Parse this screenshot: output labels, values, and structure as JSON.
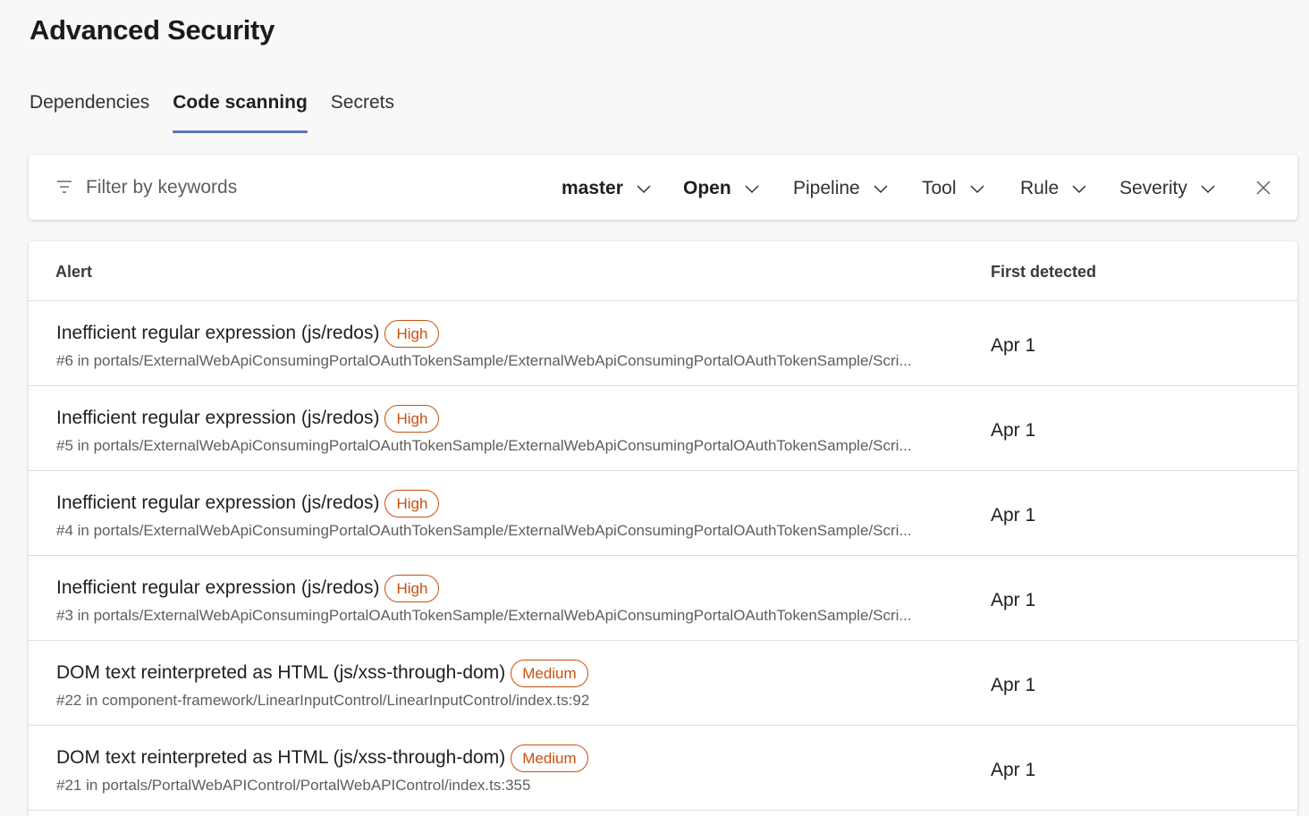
{
  "page": {
    "title": "Advanced Security"
  },
  "tabs": [
    {
      "label": "Dependencies",
      "active": false
    },
    {
      "label": "Code scanning",
      "active": true
    },
    {
      "label": "Secrets",
      "active": false
    }
  ],
  "filter": {
    "placeholder": "Filter by keywords",
    "dropdowns": [
      {
        "label": "master",
        "bold": true
      },
      {
        "label": "Open",
        "bold": true
      },
      {
        "label": "Pipeline",
        "bold": false
      },
      {
        "label": "Tool",
        "bold": false
      },
      {
        "label": "Rule",
        "bold": false
      },
      {
        "label": "Severity",
        "bold": false
      }
    ]
  },
  "table": {
    "headers": {
      "alert": "Alert",
      "first_detected": "First detected"
    },
    "rows": [
      {
        "title": "Inefficient regular expression (js/redos)",
        "severity": "High",
        "subtitle": "#6 in portals/ExternalWebApiConsumingPortalOAuthTokenSample/ExternalWebApiConsumingPortalOAuthTokenSample/Scri...",
        "first_detected": "Apr 1"
      },
      {
        "title": "Inefficient regular expression (js/redos)",
        "severity": "High",
        "subtitle": "#5 in portals/ExternalWebApiConsumingPortalOAuthTokenSample/ExternalWebApiConsumingPortalOAuthTokenSample/Scri...",
        "first_detected": "Apr 1"
      },
      {
        "title": "Inefficient regular expression (js/redos)",
        "severity": "High",
        "subtitle": "#4 in portals/ExternalWebApiConsumingPortalOAuthTokenSample/ExternalWebApiConsumingPortalOAuthTokenSample/Scri...",
        "first_detected": "Apr 1"
      },
      {
        "title": "Inefficient regular expression (js/redos)",
        "severity": "High",
        "subtitle": "#3 in portals/ExternalWebApiConsumingPortalOAuthTokenSample/ExternalWebApiConsumingPortalOAuthTokenSample/Scri...",
        "first_detected": "Apr 1"
      },
      {
        "title": "DOM text reinterpreted as HTML (js/xss-through-dom)",
        "severity": "Medium",
        "subtitle": "#22 in component-framework/LinearInputControl/LinearInputControl/index.ts:92",
        "first_detected": "Apr 1"
      },
      {
        "title": "DOM text reinterpreted as HTML (js/xss-through-dom)",
        "severity": "Medium",
        "subtitle": "#21 in portals/PortalWebAPIControl/PortalWebAPIControl/index.ts:355",
        "first_detected": "Apr 1"
      }
    ]
  },
  "colors": {
    "severity_accent": "#ca5010",
    "tab_underline": "#5a77b4",
    "page_background": "#f8f8f8"
  },
  "icons": {
    "filter": "filter-icon",
    "dropdown": "chevron-down-icon",
    "clear": "close-icon"
  }
}
